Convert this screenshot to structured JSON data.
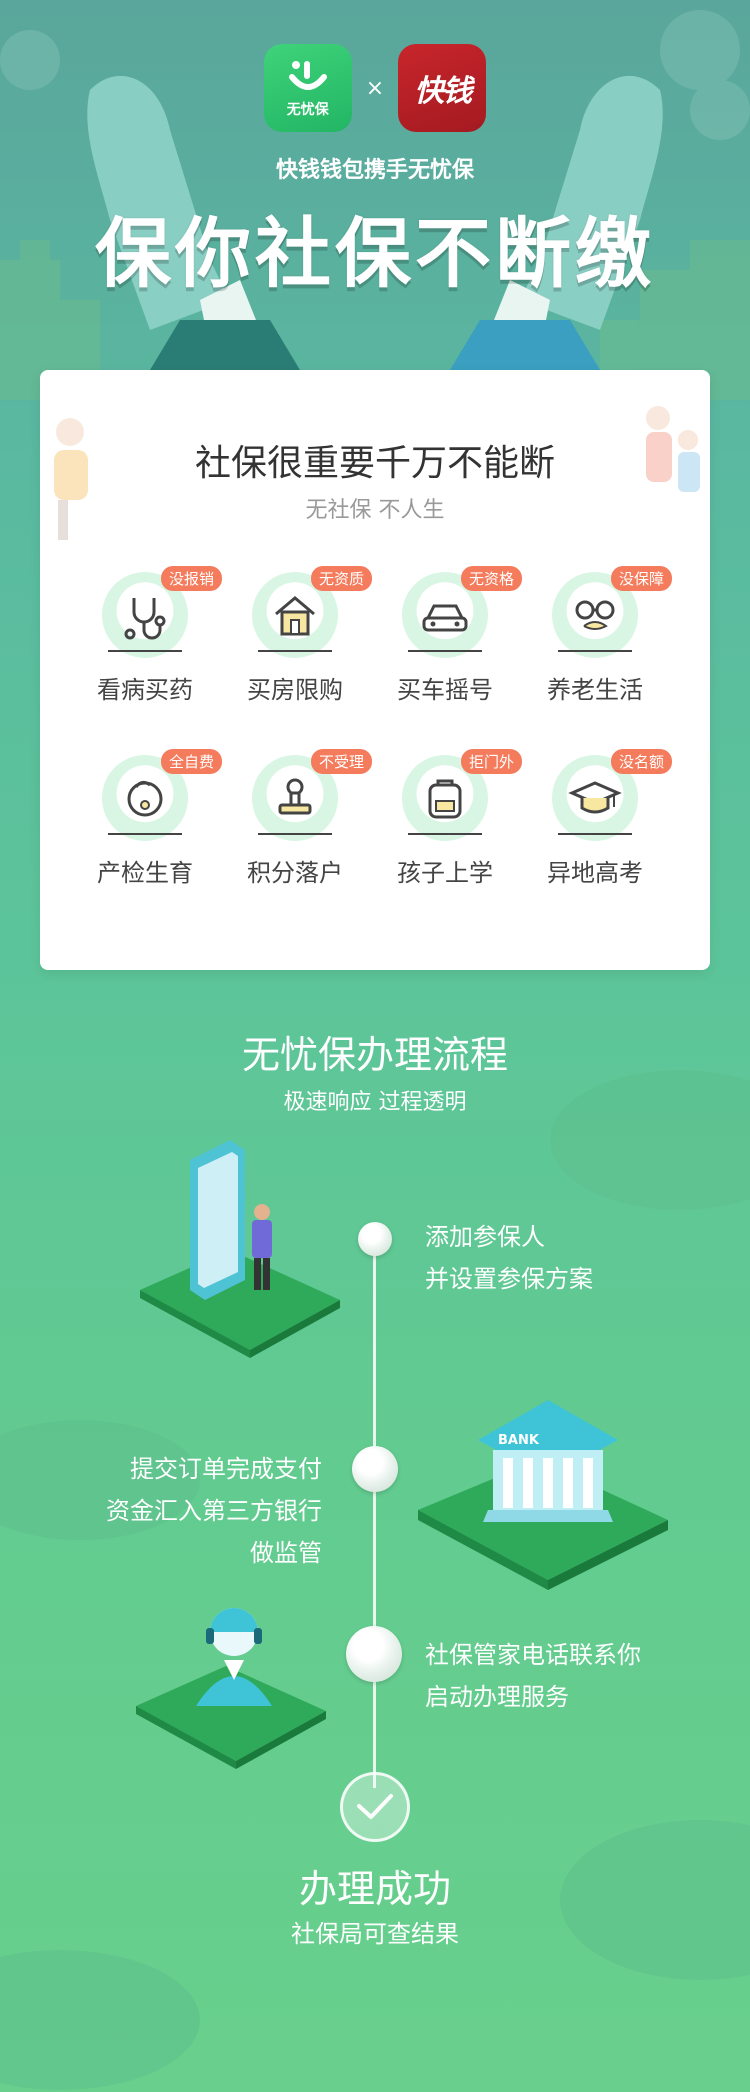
{
  "header": {
    "logo_left_label": "无忧保",
    "logo_right_label": "快钱",
    "times_sign": "×",
    "subtitle": "快钱钱包携手无忧保",
    "title": "保你社保不断缴"
  },
  "card": {
    "title": "社保很重要千万不能断",
    "subtitle": "无社保  不人生",
    "items": [
      {
        "label": "看病买药",
        "badge": "没报销",
        "icon": "stethoscope-icon"
      },
      {
        "label": "买房限购",
        "badge": "无资质",
        "icon": "house-icon"
      },
      {
        "label": "买车摇号",
        "badge": "无资格",
        "icon": "car-icon"
      },
      {
        "label": "养老生活",
        "badge": "没保障",
        "icon": "elder-glasses-icon"
      },
      {
        "label": "产检生育",
        "badge": "全自费",
        "icon": "baby-icon"
      },
      {
        "label": "积分落户",
        "badge": "不受理",
        "icon": "stamp-icon"
      },
      {
        "label": "孩子上学",
        "badge": "拒门外",
        "icon": "backpack-icon"
      },
      {
        "label": "异地高考",
        "badge": "没名额",
        "icon": "graduation-cap-icon"
      }
    ]
  },
  "process": {
    "title": "无忧保办理流程",
    "subtitle": "极速响应  过程透明",
    "steps": [
      {
        "line1": "添加参保人",
        "line2": "并设置参保方案",
        "line3": ""
      },
      {
        "line1": "提交订单完成支付",
        "line2": "资金汇入第三方银行",
        "line3": "做监管"
      },
      {
        "line1": "社保管家电话联系你",
        "line2": "启动办理服务",
        "line3": ""
      }
    ],
    "bank_sign": "BANK",
    "success_title": "办理成功",
    "success_sub": "社保局可查结果"
  },
  "colors": {
    "accent_green": "#22b564",
    "brand_red": "#b31f25",
    "badge_orange": "#f47b5c",
    "icon_bg": "#d8f6e3"
  }
}
